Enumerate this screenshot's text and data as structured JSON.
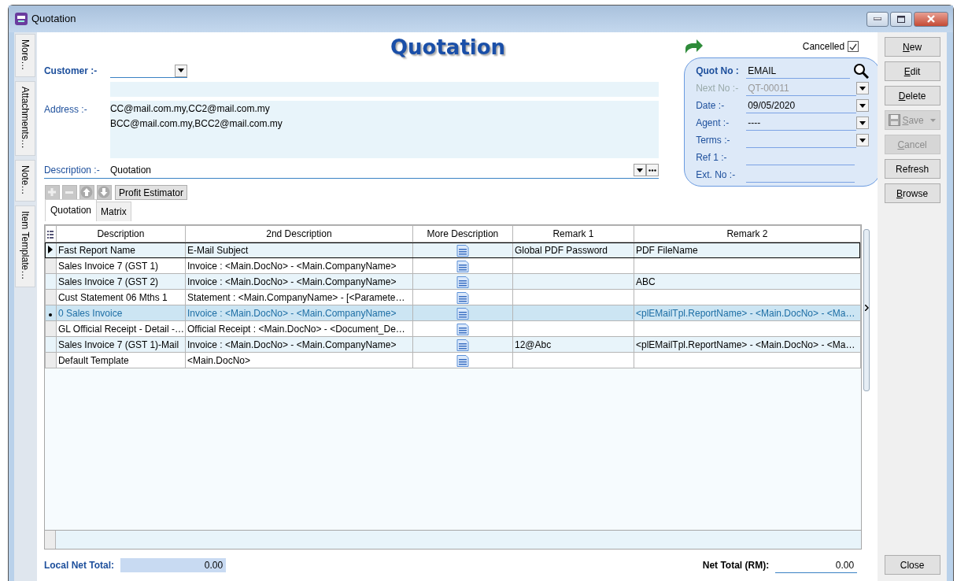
{
  "window": {
    "title": "Quotation"
  },
  "side_tabs": [
    "More…",
    "Attachments…",
    "Note…",
    "Item Template…"
  ],
  "heading": "Quotation",
  "cancelled": {
    "label": "Cancelled",
    "checked": true
  },
  "customer": {
    "label": "Customer :-"
  },
  "address": {
    "label": "Address :-",
    "lines": [
      "CC@mail.com.my,CC2@mail.com.my",
      "BCC@mail.com.my,BCC2@mail.com.my"
    ]
  },
  "description": {
    "label": "Description :-",
    "value": "Quotation"
  },
  "toolbar": {
    "profit_button": "Profit Estimator"
  },
  "tabs": [
    {
      "label": "Quotation",
      "selected": true
    },
    {
      "label": "Matrix",
      "selected": false
    }
  ],
  "table": {
    "columns": [
      "Description",
      "2nd Description",
      "More Description",
      "Remark 1",
      "Remark 2"
    ],
    "rows": [
      {
        "current": true,
        "selected": false,
        "cells": {
          "description": "Fast Report Name",
          "second": "E-Mail Subject",
          "remark_1": "Global PDF Password",
          "remark_2": "PDF FileName"
        }
      },
      {
        "current": false,
        "selected": false,
        "cells": {
          "description": "Sales Invoice 7 (GST 1)",
          "second": "Invoice :  <Main.DocNo> - <Main.CompanyName>"
        }
      },
      {
        "current": false,
        "selected": false,
        "cells": {
          "description": "Sales Invoice 7 (GST 2)",
          "second": "Invoice :  <Main.DocNo> - <Main.CompanyName>",
          "remark_2": "ABC"
        }
      },
      {
        "current": false,
        "selected": false,
        "cells": {
          "description": "Cust Statement 06 Mths 1",
          "second": "Statement : <Main.CompanyName> - [<Paramete…"
        }
      },
      {
        "current": false,
        "selected": true,
        "cells": {
          "description": "0 Sales Invoice",
          "second": "Invoice :  <Main.DocNo> - <Main.CompanyName>",
          "remark_2": "<plEMailTpl.ReportName> - <Main.DocNo> - <Ma…"
        }
      },
      {
        "current": false,
        "selected": false,
        "cells": {
          "description": "GL Official Receipt - Detail -…",
          "second": "Official Receipt : <Main.DocNo> - <Document_De…"
        }
      },
      {
        "current": false,
        "selected": false,
        "cells": {
          "description": "Sales Invoice 7 (GST 1)-Mail",
          "second": "Invoice :  <Main.DocNo> - <Main.CompanyName>",
          "remark_1": "12@Abc",
          "remark_2": "<plEMailTpl.ReportName> - <Main.DocNo> - <Ma…"
        }
      },
      {
        "current": false,
        "selected": false,
        "cells": {
          "description": "Default Template",
          "second": "<Main.DocNo>"
        }
      }
    ]
  },
  "doc_panel": {
    "fields": [
      {
        "kind": "search",
        "label": "Quot No :",
        "value": "EMAIL",
        "disabled": false
      },
      {
        "kind": "dropdown",
        "label": "Next No :-",
        "value": "QT-00011",
        "disabled": true
      },
      {
        "kind": "dropdown",
        "label": "Date :-",
        "value": "09/05/2020",
        "disabled": false
      },
      {
        "kind": "dropdown",
        "label": "Agent :-",
        "value": "----",
        "disabled": false
      },
      {
        "kind": "dropdown",
        "label": "Terms :-",
        "disabled": false
      },
      {
        "kind": "text",
        "label": "Ref 1 :-",
        "disabled": false
      },
      {
        "kind": "text",
        "label": "Ext. No :-",
        "disabled": false
      }
    ]
  },
  "buttons": [
    {
      "kind": "plain",
      "accel": "N",
      "after": "ew",
      "disabled": false
    },
    {
      "kind": "plain",
      "accel": "E",
      "after": "dit",
      "disabled": false
    },
    {
      "kind": "plain",
      "accel": "D",
      "after": "elete",
      "disabled": false
    },
    {
      "kind": "split",
      "accel": "S",
      "after": "ave",
      "disabled": true
    },
    {
      "kind": "plain",
      "accel": "C",
      "after": "ancel",
      "disabled": true
    },
    {
      "kind": "plain",
      "before": "Refresh",
      "disabled": false
    },
    {
      "kind": "plain",
      "accel": "B",
      "after": "rowse",
      "disabled": false
    }
  ],
  "footer": {
    "local_label": "Local Net Total:",
    "local_value": "0.00",
    "net_label": "Net Total (RM):",
    "net_value": "0.00"
  },
  "close_button": "Close"
}
